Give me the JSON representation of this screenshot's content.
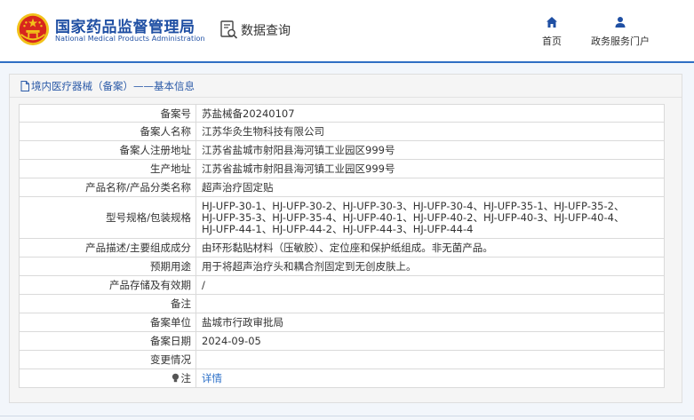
{
  "header": {
    "brand_cn": "国家药品监督管理局",
    "brand_en": "National Medical Products Administration",
    "data_query": "数据查询",
    "nav": [
      {
        "label": "首页",
        "icon": "home-icon"
      },
      {
        "label": "政务服务门户",
        "icon": "user-icon"
      }
    ],
    "colors": {
      "brand": "#1f4fa3",
      "accent": "#2f6fc4",
      "emblem_red": "#d7261e",
      "emblem_gold": "#f2c21a"
    }
  },
  "panel": {
    "title": "境内医疗器械（备案）——基本信息"
  },
  "rows": [
    {
      "label": "备案号",
      "value": "苏盐械备20240107"
    },
    {
      "label": "备案人名称",
      "value": "江苏华灸生物科技有限公司"
    },
    {
      "label": "备案人注册地址",
      "value": "江苏省盐城市射阳县海河镇工业园区999号"
    },
    {
      "label": "生产地址",
      "value": "江苏省盐城市射阳县海河镇工业园区999号"
    },
    {
      "label": "产品名称/产品分类名称",
      "value": "超声治疗固定贴"
    },
    {
      "label": "型号规格/包装规格",
      "lines": [
        "HJ-UFP-30-1、HJ-UFP-30-2、HJ-UFP-30-3、HJ-UFP-30-4、HJ-UFP-35-1、HJ-UFP-35-2、",
        "HJ-UFP-35-3、HJ-UFP-35-4、HJ-UFP-40-1、HJ-UFP-40-2、HJ-UFP-40-3、HJ-UFP-40-4、",
        "HJ-UFP-44-1、HJ-UFP-44-2、HJ-UFP-44-3、HJ-UFP-44-4"
      ]
    },
    {
      "label": "产品描述/主要组成成分",
      "value": "由环形黏贴材料（压敏胶）、定位座和保护纸组成。非无菌产品。"
    },
    {
      "label": "预期用途",
      "value": "用于将超声治疗头和耦合剂固定到无创皮肤上。"
    },
    {
      "label": "产品存储及有效期",
      "value": "/"
    },
    {
      "label": "备注",
      "value": ""
    },
    {
      "label": "备案单位",
      "value": "盐城市行政审批局"
    },
    {
      "label": "备案日期",
      "value": "2024-09-05"
    },
    {
      "label": "变更情况",
      "value": ""
    },
    {
      "label": "注",
      "value": "详情",
      "icon": "bulb-icon"
    }
  ]
}
